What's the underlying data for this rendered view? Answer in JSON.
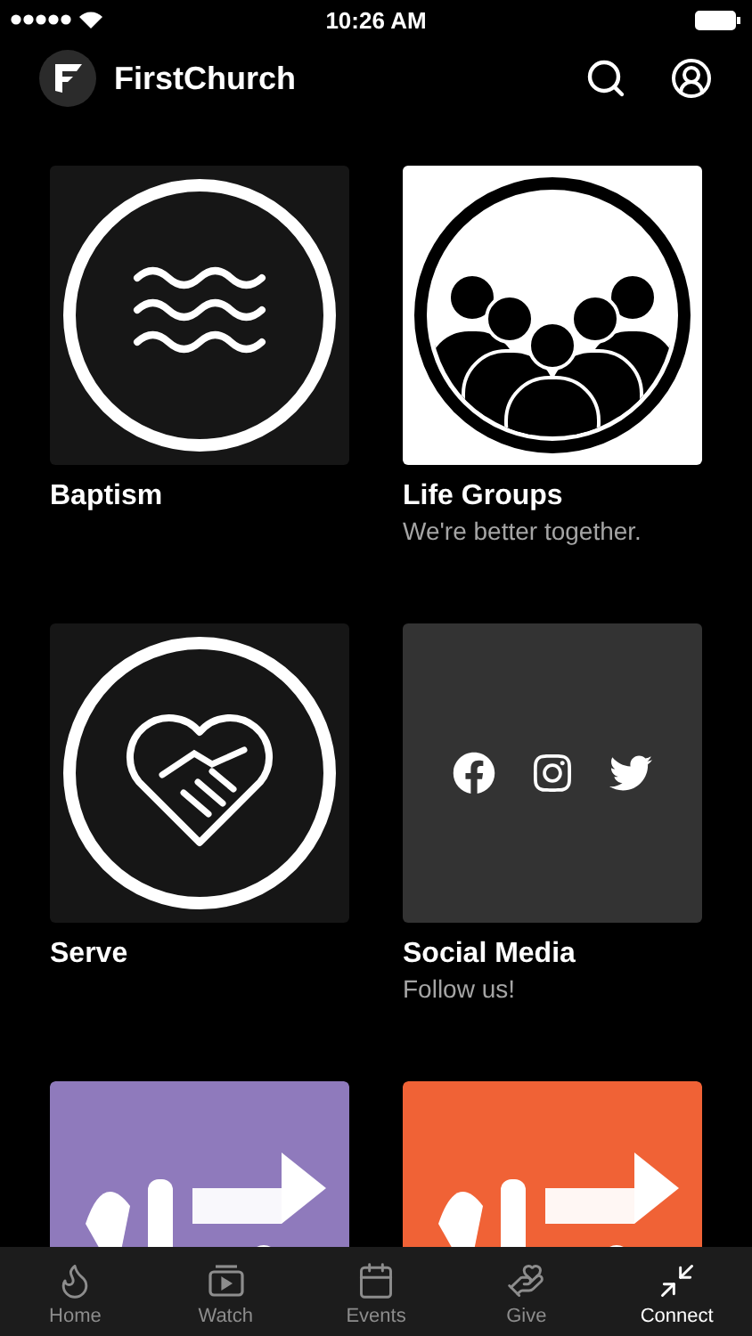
{
  "status_bar": {
    "time": "10:26 AM"
  },
  "header": {
    "title": "FirstChurch"
  },
  "tiles": [
    {
      "kind": "waves",
      "title": "Baptism"
    },
    {
      "kind": "people",
      "title": "Life Groups",
      "subtitle": "We're better together."
    },
    {
      "kind": "heart",
      "title": "Serve"
    },
    {
      "kind": "social",
      "title": "Social Media",
      "subtitle": "Follow us!"
    },
    {
      "kind": "picture",
      "color": "#8f7abc"
    },
    {
      "kind": "picture",
      "color": "#f06236"
    }
  ],
  "tab_bar": [
    {
      "kind": "flame",
      "label": "Home",
      "selected": false
    },
    {
      "kind": "watch",
      "label": "Watch",
      "selected": false
    },
    {
      "kind": "calendar",
      "label": "Events",
      "selected": false
    },
    {
      "kind": "give",
      "label": "Give",
      "selected": false
    },
    {
      "kind": "connect",
      "label": "Connect",
      "selected": true
    }
  ]
}
